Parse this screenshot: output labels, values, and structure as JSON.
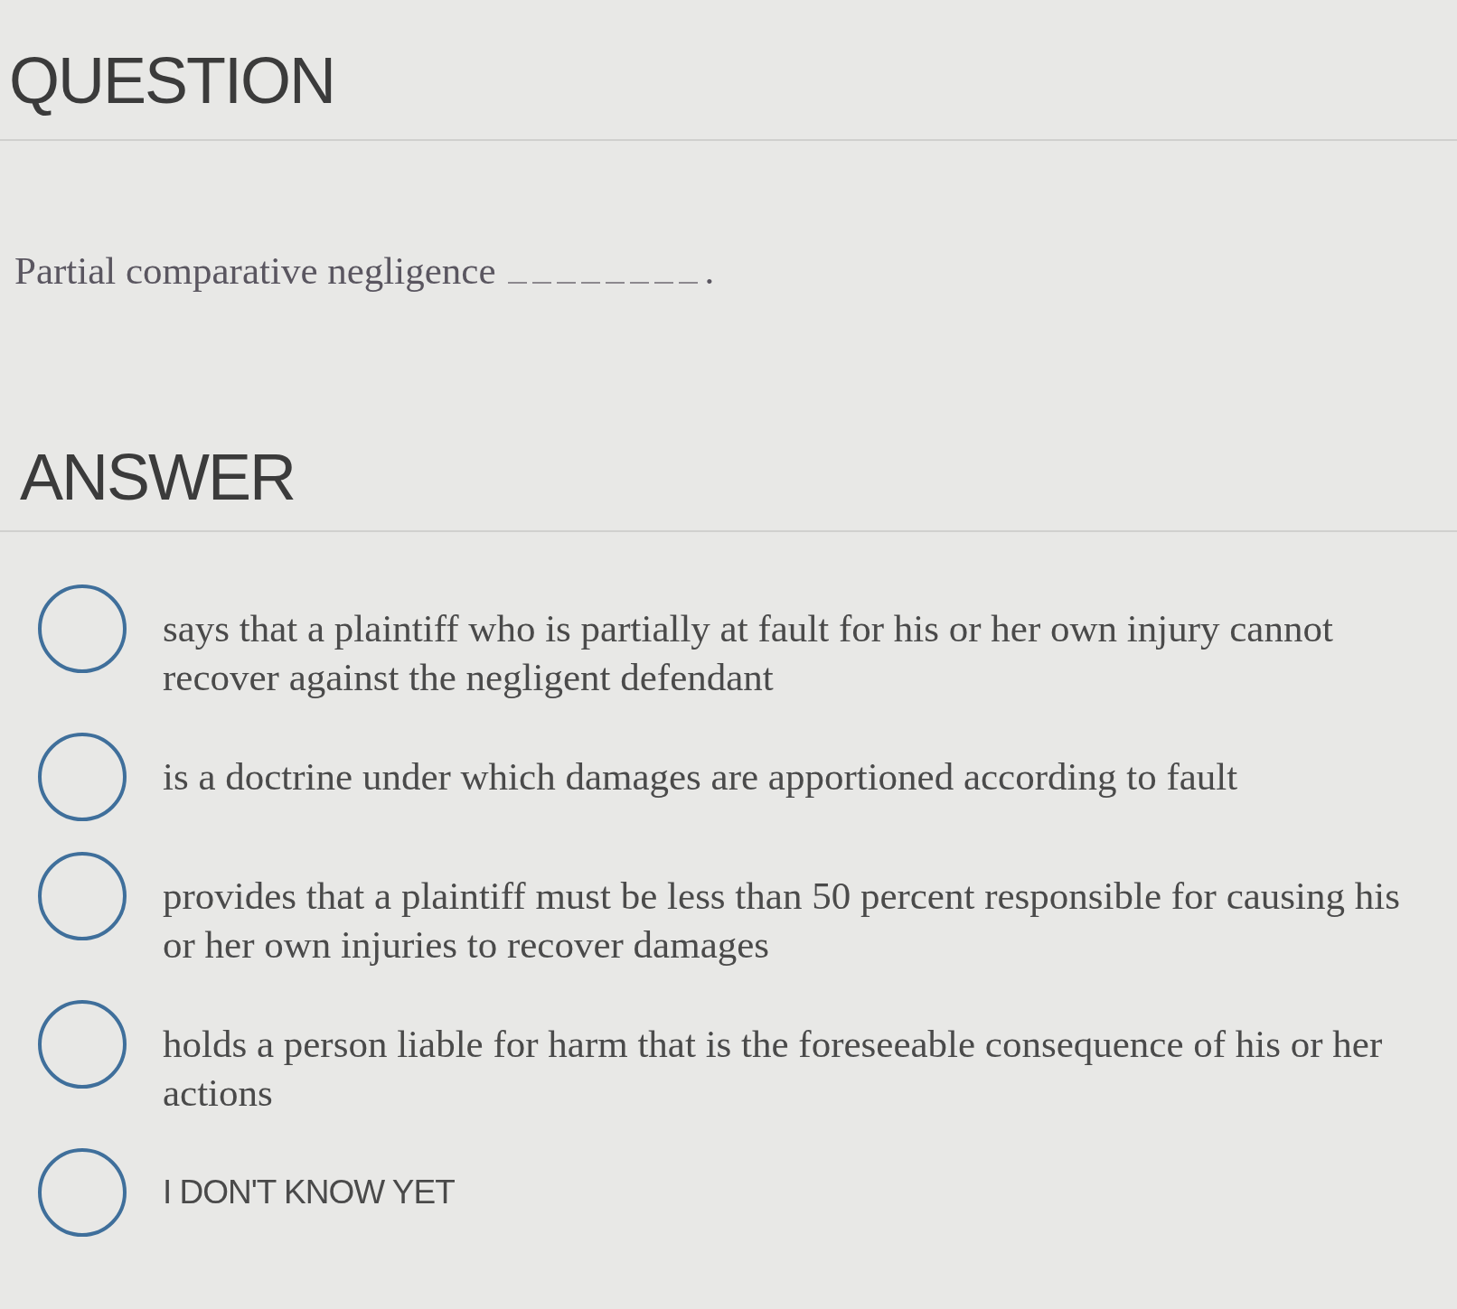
{
  "question_heading": "QUESTION",
  "question": {
    "parts": [
      {
        "kind": "text",
        "text": "Partial comparative negligence"
      },
      {
        "kind": "blank"
      },
      {
        "kind": "text",
        "text": "."
      }
    ]
  },
  "answer_heading": "ANSWER",
  "options": [
    {
      "text": "says that a plaintiff who is partially at fault for his or her own injury cannot recover against the negligent defendant",
      "selected": false
    },
    {
      "text": "is a doctrine under which damages are apportioned according to fault",
      "selected": false
    },
    {
      "text": "provides that a plaintiff must be less than 50 percent responsible for causing his or her own injuries to recover damages",
      "selected": false
    },
    {
      "text": "holds a person liable for harm that is the foreseeable consequence of his or her actions",
      "selected": false
    },
    {
      "text": "I DON'T KNOW YET",
      "selected": false,
      "kind": "plain"
    }
  ]
}
